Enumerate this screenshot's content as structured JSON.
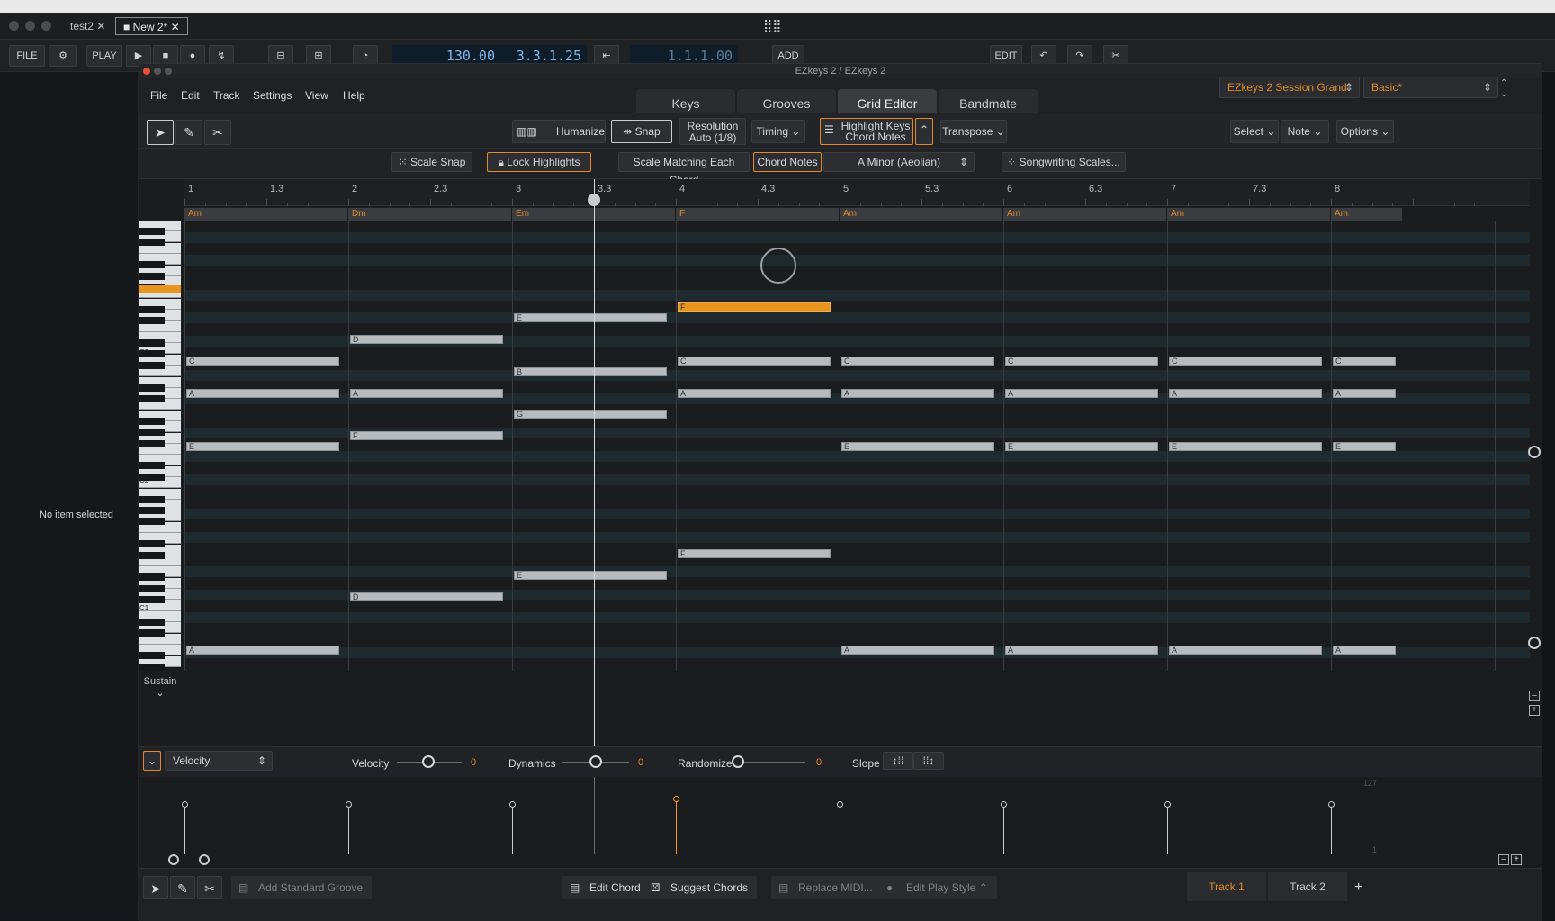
{
  "host": {
    "tabs": [
      "test2",
      "New 2*"
    ],
    "transport": {
      "file": "FILE",
      "play": "PLAY",
      "tempo": "130.00",
      "position": "3.3.1.25",
      "loop_position": "1.1.1.00",
      "add": "ADD",
      "edit": "EDIT"
    },
    "left_panel_text": "No item selected"
  },
  "plugin": {
    "window_title": "EZkeys 2 / EZkeys 2",
    "menus": [
      "File",
      "Edit",
      "Track",
      "Settings",
      "View",
      "Help"
    ],
    "tabs": [
      "Keys",
      "Grooves",
      "Grid Editor",
      "Bandmate"
    ],
    "active_tab": "Grid Editor",
    "instrument": "EZkeys 2 Session Grand",
    "preset": "Basic*"
  },
  "toolbar1": {
    "humanize": "Humanize",
    "snap": "Snap",
    "resolution_line1": "Resolution",
    "resolution_line2": "Auto (1/8)",
    "timing": "Timing",
    "highlight_line1": "Highlight Keys",
    "highlight_line2": "Chord Notes",
    "transpose": "Transpose",
    "select": "Select",
    "note": "Note",
    "options": "Options"
  },
  "toolbar2": {
    "scale_snap": "Scale Snap",
    "lock_highlights": "Lock Highlights",
    "scale_matching": "Scale Matching Each Chord",
    "chord_notes": "Chord Notes",
    "scale": "A Minor (Aeolian)",
    "songwriting": "Songwriting Scales..."
  },
  "ruler": {
    "labels": [
      "1",
      "1.3",
      "2",
      "2.3",
      "3",
      "3.3",
      "4",
      "4.3",
      "5",
      "5.3",
      "6",
      "6.3",
      "7",
      "7.3",
      "8"
    ]
  },
  "chords": [
    "Am",
    "Dm",
    "Em",
    "F",
    "Am",
    "Am",
    "Am",
    "Am"
  ],
  "octaves": [
    "C3",
    "C2",
    "C1"
  ],
  "sustain": "Sustain",
  "notes": [
    {
      "bar": 0,
      "row": 11,
      "label": "C"
    },
    {
      "bar": 0,
      "row": 14,
      "label": "A"
    },
    {
      "bar": 0,
      "row": 19,
      "label": "E"
    },
    {
      "bar": 0,
      "row": 38,
      "label": "A"
    },
    {
      "bar": 1,
      "row": 9,
      "label": "D"
    },
    {
      "bar": 1,
      "row": 14,
      "label": "A"
    },
    {
      "bar": 1,
      "row": 18,
      "label": "F"
    },
    {
      "bar": 1,
      "row": 33,
      "label": "D"
    },
    {
      "bar": 2,
      "row": 7,
      "label": "E"
    },
    {
      "bar": 2,
      "row": 12,
      "label": "B"
    },
    {
      "bar": 2,
      "row": 16,
      "label": "G"
    },
    {
      "bar": 2,
      "row": 31,
      "label": "E"
    },
    {
      "bar": 3,
      "row": 6,
      "label": "F",
      "highlight": true
    },
    {
      "bar": 3,
      "row": 11,
      "label": "C"
    },
    {
      "bar": 3,
      "row": 14,
      "label": "A"
    },
    {
      "bar": 3,
      "row": 29,
      "label": "F"
    },
    {
      "bar": 4,
      "row": 11,
      "label": "C"
    },
    {
      "bar": 4,
      "row": 14,
      "label": "A"
    },
    {
      "bar": 4,
      "row": 19,
      "label": "E"
    },
    {
      "bar": 4,
      "row": 38,
      "label": "A"
    },
    {
      "bar": 5,
      "row": 11,
      "label": "C"
    },
    {
      "bar": 5,
      "row": 14,
      "label": "A"
    },
    {
      "bar": 5,
      "row": 19,
      "label": "E"
    },
    {
      "bar": 5,
      "row": 38,
      "label": "A"
    },
    {
      "bar": 6,
      "row": 11,
      "label": "C"
    },
    {
      "bar": 6,
      "row": 14,
      "label": "A"
    },
    {
      "bar": 6,
      "row": 19,
      "label": "E"
    },
    {
      "bar": 6,
      "row": 38,
      "label": "A"
    },
    {
      "bar": 7,
      "row": 11,
      "label": "C"
    },
    {
      "bar": 7,
      "row": 14,
      "label": "A"
    },
    {
      "bar": 7,
      "row": 19,
      "label": "E"
    },
    {
      "bar": 7,
      "row": 38,
      "label": "A"
    }
  ],
  "velocity": {
    "lane": "Velocity",
    "velocity_label": "Velocity",
    "velocity_value": "0",
    "dynamics_label": "Dynamics",
    "dynamics_value": "0",
    "randomize_label": "Randomize",
    "randomize_value": "0",
    "slope_label": "Slope",
    "max": "127",
    "min": "1"
  },
  "bottom": {
    "add_groove": "Add Standard Groove",
    "edit_chord": "Edit Chord",
    "suggest_chords": "Suggest Chords",
    "replace_midi": "Replace MIDI...",
    "edit_play_style": "Edit Play Style",
    "tracks": [
      "Track 1",
      "Track 2"
    ]
  }
}
